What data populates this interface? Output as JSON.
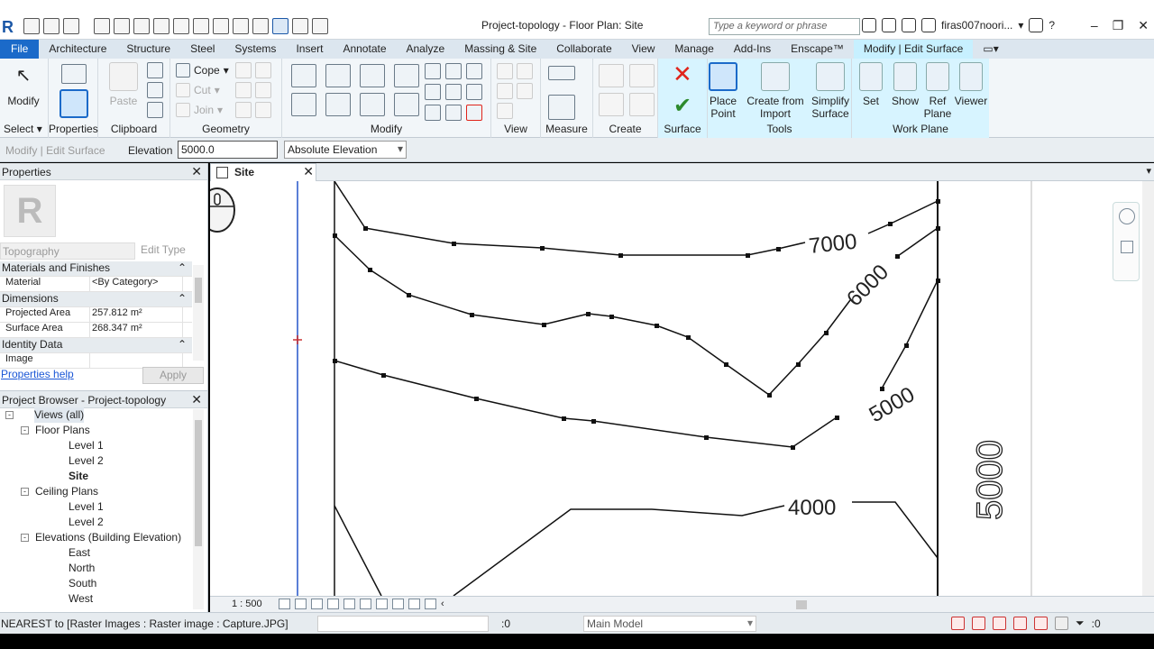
{
  "window": {
    "title": "Project-topology - Floor Plan: Site",
    "search_placeholder": "Type a keyword or phrase",
    "user": "firas007noori...",
    "help": "?"
  },
  "ribbon_tabs": [
    {
      "label": "File"
    },
    {
      "label": "Architecture"
    },
    {
      "label": "Structure"
    },
    {
      "label": "Steel"
    },
    {
      "label": "Systems"
    },
    {
      "label": "Insert"
    },
    {
      "label": "Annotate"
    },
    {
      "label": "Analyze"
    },
    {
      "label": "Massing & Site"
    },
    {
      "label": "Collaborate"
    },
    {
      "label": "View"
    },
    {
      "label": "Manage"
    },
    {
      "label": "Add-Ins"
    },
    {
      "label": "Enscape™"
    },
    {
      "label": "Modify | Edit Surface"
    }
  ],
  "ribbon": {
    "modify": "Modify",
    "select": "Select",
    "clipboard": {
      "label": "Clipboard",
      "paste": "Paste"
    },
    "geometry": {
      "label": "Geometry",
      "cope": "Cope",
      "cut": "Cut",
      "join": "Join"
    },
    "properties_panel": "Properties",
    "modify_panel": "Modify",
    "view_panel": "View",
    "measure_panel": "Measure",
    "create_panel": "Create",
    "surface_panel": "Surface",
    "tools": {
      "label": "Tools",
      "place_point": "Place Point",
      "create_from_import": "Create from Import",
      "simplify_surface": "Simplify Surface"
    },
    "work_plane": {
      "label": "Work Plane",
      "set": "Set",
      "show": "Show",
      "ref_plane": "Ref Plane",
      "viewer": "Viewer"
    }
  },
  "options_bar": {
    "context": "Modify | Edit Surface",
    "elevation_label": "Elevation",
    "elevation_value": "5000.0",
    "elevation_mode": "Absolute Elevation"
  },
  "properties": {
    "title": "Properties",
    "type": "Topography",
    "edit_type": "Edit Type",
    "groups": [
      {
        "name": "Materials and Finishes",
        "rows": [
          {
            "k": "Material",
            "v": "<By Category>"
          }
        ]
      },
      {
        "name": "Dimensions",
        "rows": [
          {
            "k": "Projected Area",
            "v": "257.812 m²"
          },
          {
            "k": "Surface Area",
            "v": "268.347 m²"
          }
        ]
      },
      {
        "name": "Identity Data",
        "rows": [
          {
            "k": "Image",
            "v": ""
          }
        ]
      }
    ],
    "help": "Properties help",
    "apply": "Apply"
  },
  "browser": {
    "title": "Project Browser - Project-topology",
    "nodes": [
      {
        "label": "Views (all)",
        "level": 0,
        "toggle": "-"
      },
      {
        "label": "Floor Plans",
        "level": 1,
        "toggle": "-"
      },
      {
        "label": "Level 1",
        "level": 2
      },
      {
        "label": "Level 2",
        "level": 2
      },
      {
        "label": "Site",
        "level": 2,
        "bold": true
      },
      {
        "label": "Ceiling Plans",
        "level": 1,
        "toggle": "-"
      },
      {
        "label": "Level 1",
        "level": 2
      },
      {
        "label": "Level 2",
        "level": 2
      },
      {
        "label": "Elevations (Building Elevation)",
        "level": 1,
        "toggle": "-"
      },
      {
        "label": "East",
        "level": 2
      },
      {
        "label": "North",
        "level": 2
      },
      {
        "label": "South",
        "level": 2
      },
      {
        "label": "West",
        "level": 2
      }
    ]
  },
  "view": {
    "tab": "Site",
    "scale": "1 : 500",
    "contours": {
      "c7000": "7000",
      "c6000": "6000",
      "c5000": "5000",
      "c4000": "4000",
      "c5000b": "5000"
    }
  },
  "status": {
    "message": "NEAREST  to [Raster Images : Raster image : Capture.JPG]",
    "count": ":0",
    "model": "Main Model",
    "filter": ":0"
  }
}
